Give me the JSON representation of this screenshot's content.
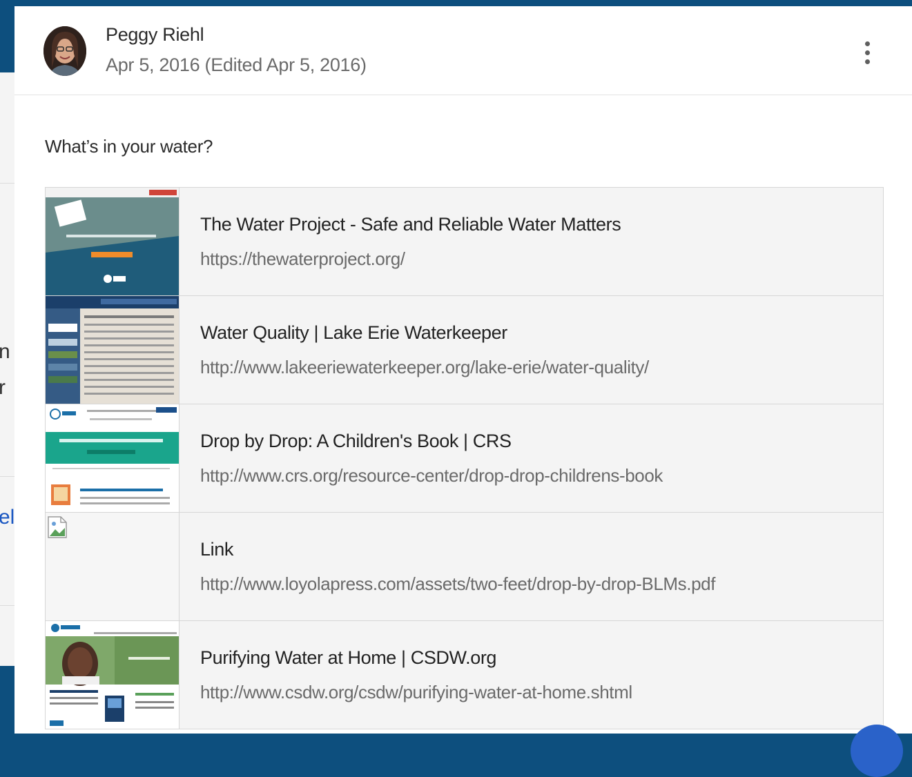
{
  "post": {
    "author": "Peggy Riehl",
    "date": "Apr 5, 2016 (Edited Apr 5, 2016)",
    "text": "What’s in your water?"
  },
  "background_fragments": [
    "n",
    "r",
    "el"
  ],
  "attachments": [
    {
      "title": "The Water Project - Safe and Reliable Water Matters",
      "url": "https://thewaterproject.org/"
    },
    {
      "title": "Water Quality | Lake Erie Waterkeeper",
      "url": "http://www.lakeeriewaterkeeper.org/lake-erie/water-quality/"
    },
    {
      "title": "Drop by Drop: A Children's Book | CRS",
      "url": "http://www.crs.org/resource-center/drop-drop-childrens-book"
    },
    {
      "title": "Link",
      "url": "http://www.loyolapress.com/assets/two-feet/drop-by-drop-BLMs.pdf"
    },
    {
      "title": "Purifying Water at Home | CSDW.org",
      "url": "http://www.csdw.org/csdw/purifying-water-at-home.shtml"
    }
  ],
  "colors": {
    "page_background": "#0d4f7e",
    "card": "#ffffff",
    "attachment_background": "#f4f4f4",
    "fab": "#2a62c9"
  }
}
